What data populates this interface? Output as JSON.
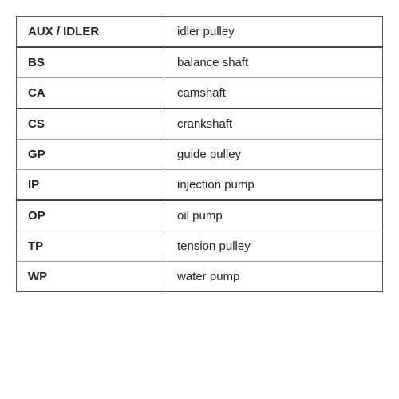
{
  "table": {
    "rows": [
      {
        "key": "AUX / IDLER",
        "value": "idler pulley",
        "thickBottom": true
      },
      {
        "key": "BS",
        "value": "balance shaft",
        "thickBottom": false
      },
      {
        "key": "CA",
        "value": "camshaft",
        "thickBottom": true
      },
      {
        "key": "CS",
        "value": "crankshaft",
        "thickBottom": false
      },
      {
        "key": "GP",
        "value": "guide pulley",
        "thickBottom": false
      },
      {
        "key": "IP",
        "value": "injection pump",
        "thickBottom": true
      },
      {
        "key": "OP",
        "value": "oil pump",
        "thickBottom": false
      },
      {
        "key": "TP",
        "value": "tension pulley",
        "thickBottom": false
      },
      {
        "key": "WP",
        "value": "water pump",
        "thickBottom": false
      }
    ]
  }
}
